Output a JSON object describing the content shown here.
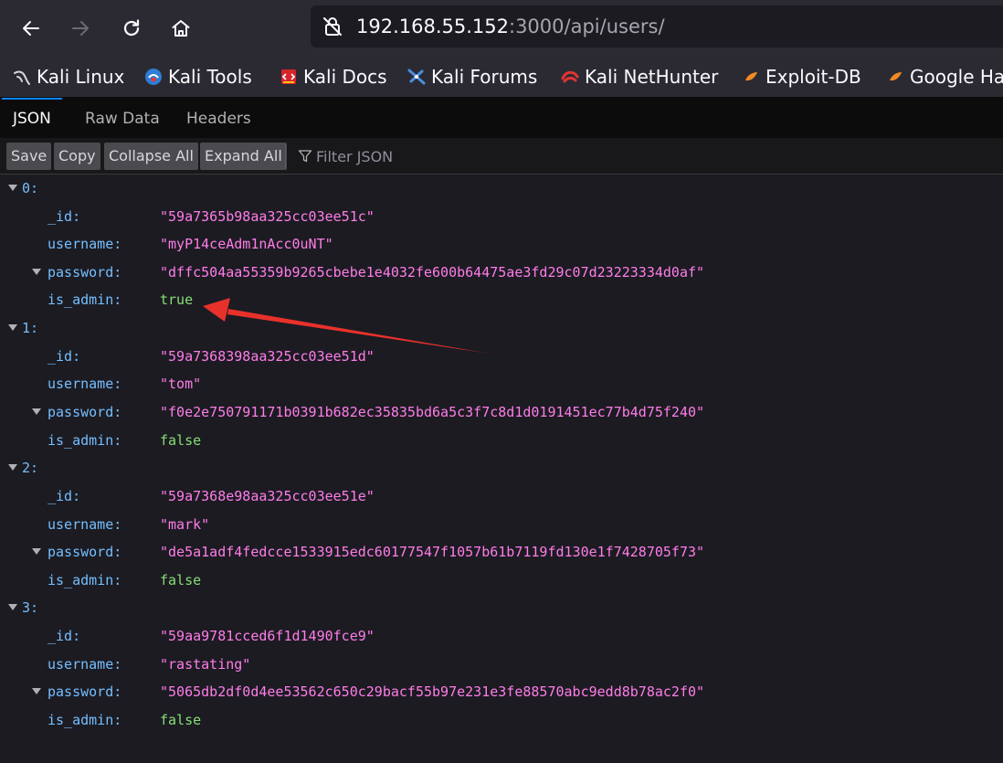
{
  "browser": {
    "nav_icons": [
      "back-arrow-icon",
      "forward-arrow-icon",
      "reload-icon",
      "home-icon"
    ],
    "url": {
      "host": "192.168.55.152",
      "rest": ":3000/api/users/"
    },
    "bookmarks": [
      {
        "label": "Kali Linux",
        "icon": "kali-dragon-icon"
      },
      {
        "label": "Kali Tools",
        "icon": "kali-tools-icon"
      },
      {
        "label": "Kali Docs",
        "icon": "kali-docs-icon"
      },
      {
        "label": "Kali Forums",
        "icon": "kali-forums-icon"
      },
      {
        "label": "Kali NetHunter",
        "icon": "kali-nethunter-icon"
      },
      {
        "label": "Exploit-DB",
        "icon": "exploit-db-icon"
      },
      {
        "label": "Google Ha",
        "icon": "google-hacking-icon"
      }
    ]
  },
  "viewer": {
    "tabs": [
      {
        "label": "JSON",
        "active": true
      },
      {
        "label": "Raw Data",
        "active": false
      },
      {
        "label": "Headers",
        "active": false
      }
    ],
    "toolbar": {
      "save": "Save",
      "copy": "Copy",
      "collapse_all": "Collapse All",
      "expand_all": "Expand All",
      "filter_placeholder": "Filter JSON"
    }
  },
  "users": [
    {
      "index": "0:",
      "_id": "\"59a7365b98aa325cc03ee51c\"",
      "username": "\"myP14ceAdm1nAcc0uNT\"",
      "password": "\"dffc504aa55359b9265cbebe1e4032fe600b64475ae3fd29c07d23223334d0af\"",
      "is_admin": "true"
    },
    {
      "index": "1:",
      "_id": "\"59a7368398aa325cc03ee51d\"",
      "username": "\"tom\"",
      "password": "\"f0e2e750791171b0391b682ec35835bd6a5c3f7c8d1d0191451ec77b4d75f240\"",
      "is_admin": "false"
    },
    {
      "index": "2:",
      "_id": "\"59a7368e98aa325cc03ee51e\"",
      "username": "\"mark\"",
      "password": "\"de5a1adf4fedcce1533915edc60177547f1057b61b7119fd130e1f7428705f73\"",
      "is_admin": "false"
    },
    {
      "index": "3:",
      "_id": "\"59aa9781cced6f1d1490fce9\"",
      "username": "\"rastating\"",
      "password": "\"5065db2df0d4ee53562c650c29bacf55b97e231e3fe88570abc9edd8b78ac2f0\"",
      "is_admin": "false"
    }
  ],
  "field_keys": {
    "id": "_id:",
    "username": "username:",
    "password": "password:",
    "is_admin": "is_admin:"
  },
  "colors": {
    "key": "#75bfff",
    "string": "#ff7de9",
    "boolean": "#86de74",
    "annotation_arrow": "#e8312b",
    "active_tab_accent": "#0a84ff"
  }
}
